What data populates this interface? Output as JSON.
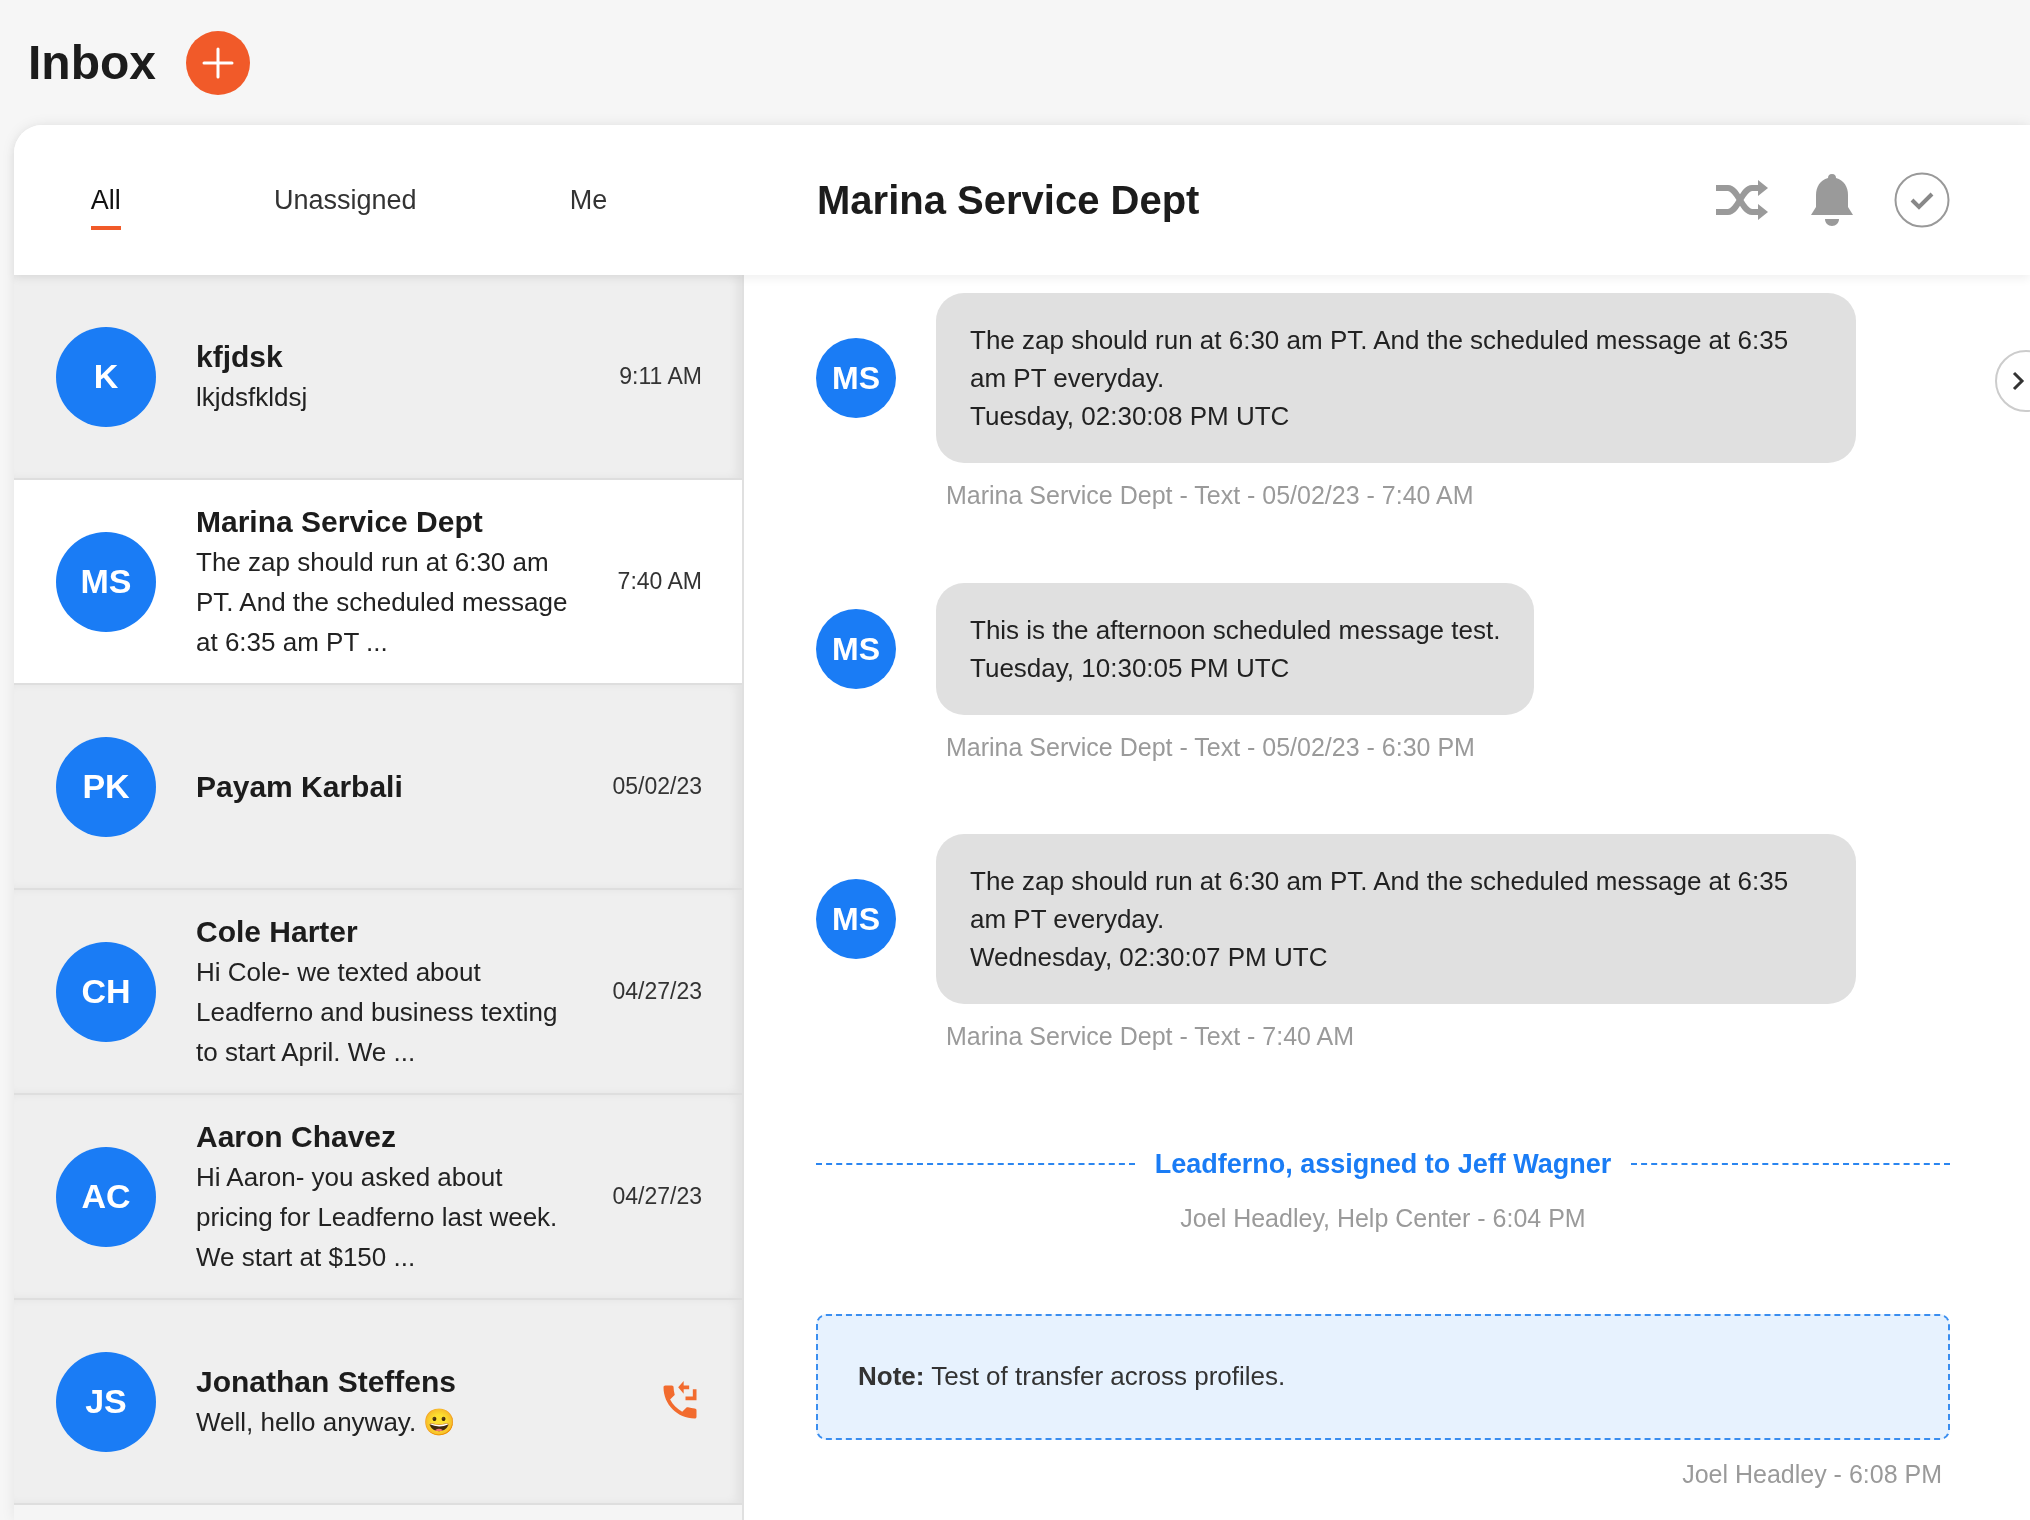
{
  "header": {
    "title": "Inbox"
  },
  "tabs": [
    {
      "label": "All",
      "selected": true
    },
    {
      "label": "Unassigned",
      "selected": false
    },
    {
      "label": "Me",
      "selected": false
    }
  ],
  "conversations": [
    {
      "kind": "time",
      "initials": "K",
      "name": "kfjdsk",
      "preview": "lkjdsfkldsj",
      "time": "9:11 AM",
      "selected": false
    },
    {
      "kind": "time",
      "initials": "MS",
      "name": "Marina Service Dept",
      "preview": "The zap should run at 6:30 am PT. And the scheduled message at 6:35 am PT ...",
      "time": "7:40 AM",
      "selected": true
    },
    {
      "kind": "time",
      "initials": "PK",
      "name": "Payam Karbali",
      "time": "05/02/23",
      "selected": false
    },
    {
      "kind": "time",
      "initials": "CH",
      "name": "Cole Harter",
      "preview": "Hi Cole- we texted about Leadferno and business texting to start April. We ...",
      "time": "04/27/23",
      "selected": false
    },
    {
      "kind": "time",
      "initials": "AC",
      "name": "Aaron Chavez",
      "preview": "Hi Aaron- you asked about pricing for Leadferno last week. We start at $150 ...",
      "time": "04/27/23",
      "selected": false
    },
    {
      "kind": "call",
      "initials": "JS",
      "name": "Jonathan Steffens",
      "preview": "Well, hello anyway. 😀",
      "selected": false
    }
  ],
  "thread": {
    "title": "Marina Service Dept",
    "messages": [
      {
        "initials": "MS",
        "text": "The zap should run at 6:30 am PT. And the scheduled message at 6:35 am PT everyday.",
        "sent": "Tuesday, 02:30:08 PM UTC",
        "meta": "Marina Service Dept - Text - 05/02/23 - 7:40 AM"
      },
      {
        "initials": "MS",
        "text": "This is the afternoon scheduled message test.",
        "sent": "Tuesday, 10:30:05 PM UTC",
        "meta": "Marina Service Dept - Text - 05/02/23 - 6:30 PM"
      },
      {
        "initials": "MS",
        "text": "The zap should run at 6:30 am PT. And the scheduled message at 6:35 am PT everyday.",
        "sent": "Wednesday, 02:30:07 PM UTC",
        "meta": "Marina Service Dept - Text - 7:40 AM"
      }
    ],
    "assignment": {
      "text": "Leadferno, assigned to Jeff Wagner",
      "meta": "Joel Headley, Help Center - 6:04 PM"
    },
    "note": {
      "text": "**Note:** Test of transfer across profiles.",
      "meta": "Joel Headley - 6:08 PM"
    }
  }
}
